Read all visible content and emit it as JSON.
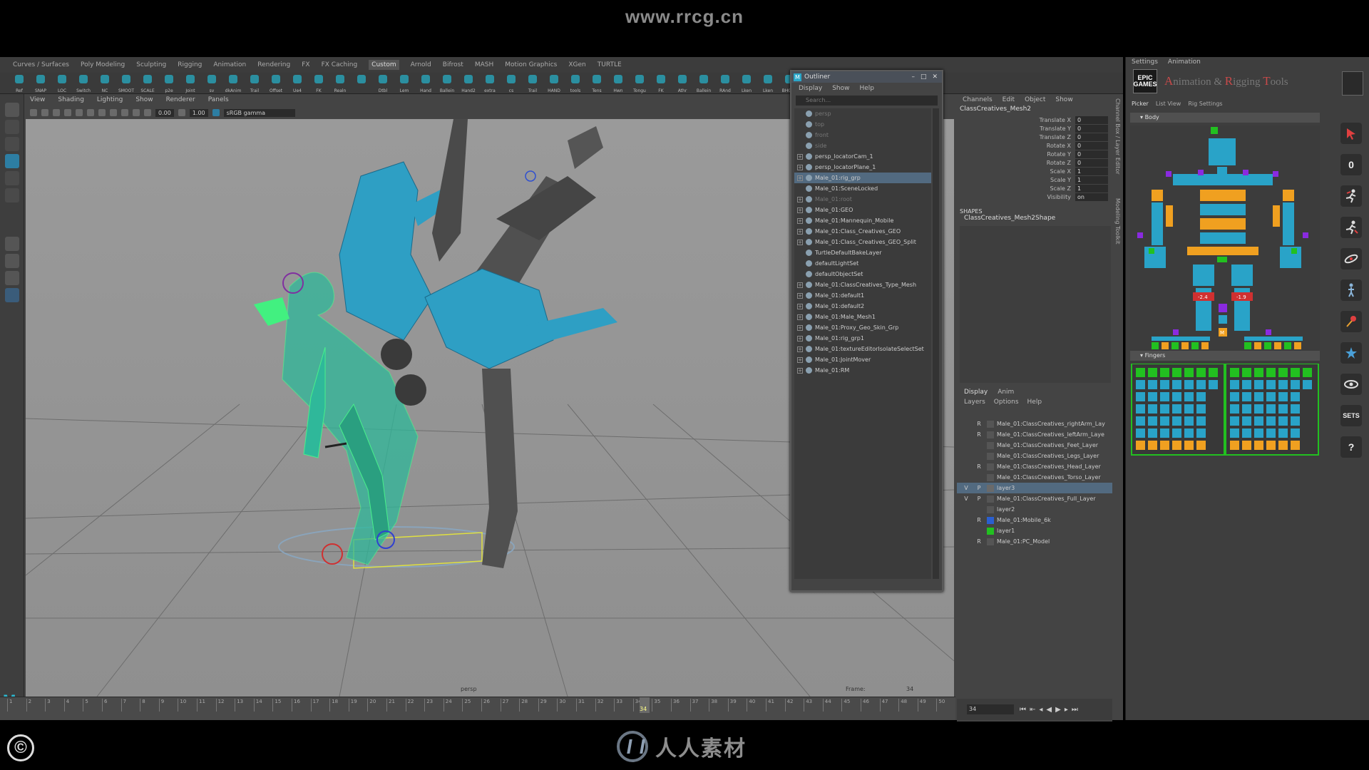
{
  "watermark": {
    "top": "www.rrcg.cn",
    "bottom": "人人素材"
  },
  "copyright_symbol": "©",
  "menubar": {
    "items": [
      "Curves / Surfaces",
      "Poly Modeling",
      "Sculpting",
      "Rigging",
      "Animation",
      "Rendering",
      "FX",
      "FX Caching",
      "Custom",
      "Arnold",
      "Bifrost",
      "MASH",
      "Motion Graphics",
      "XGen",
      "TURTLE"
    ],
    "active_index": 8
  },
  "shelf": [
    "Ref",
    "SNAP",
    "LOC",
    "Switch",
    "NC",
    "SMOOT",
    "SCALE",
    "p2e",
    "Joint",
    "sv",
    "dkAnim",
    "Trail",
    "Offset",
    "Ue4",
    "FK",
    "Realn",
    "",
    "Dtbl",
    "Lem",
    "Hand",
    "Ballein",
    "Hand2",
    "extra",
    "cs",
    "Trail",
    "HAND",
    "tools",
    "Tens",
    "Hwn",
    "Tongu",
    "FK",
    "Athr",
    "Ballein",
    "RAnd",
    "Lken",
    "Lken",
    "BHGho"
  ],
  "viewport": {
    "menu": [
      "View",
      "Shading",
      "Lighting",
      "Show",
      "Renderer",
      "Panels"
    ],
    "exposure": "0.00",
    "gamma": "1.00",
    "color_space": "sRGB gamma",
    "camera_label": "persp",
    "frame_label": "Frame:",
    "frame_value": "34"
  },
  "timeline": {
    "ticks": [
      "1",
      "2",
      "3",
      "4",
      "5",
      "6",
      "7",
      "8",
      "9",
      "10",
      "11",
      "12",
      "13",
      "14",
      "15",
      "16",
      "17",
      "18",
      "19",
      "20",
      "21",
      "22",
      "23",
      "24",
      "25",
      "26",
      "27",
      "28",
      "29",
      "30",
      "31",
      "32",
      "33",
      "34",
      "35",
      "36",
      "37",
      "38",
      "39",
      "40",
      "41",
      "42",
      "43",
      "44",
      "45",
      "46",
      "47",
      "48",
      "49",
      "50"
    ],
    "current": "34"
  },
  "outliner": {
    "title": "Outliner",
    "window_buttons": [
      "–",
      "□",
      "✕"
    ],
    "menu": [
      "Display",
      "Show",
      "Help"
    ],
    "search_placeholder": "Search...",
    "items": [
      {
        "label": "persp",
        "dim": true,
        "exp": false
      },
      {
        "label": "top",
        "dim": true,
        "exp": false
      },
      {
        "label": "front",
        "dim": true,
        "exp": false
      },
      {
        "label": "side",
        "dim": true,
        "exp": false
      },
      {
        "label": "persp_locatorCam_1",
        "dim": false,
        "exp": true
      },
      {
        "label": "persp_locatorPlane_1",
        "dim": false,
        "exp": true
      },
      {
        "label": "Male_01:rig_grp",
        "dim": false,
        "exp": true,
        "sel": true
      },
      {
        "label": "Male_01:SceneLocked",
        "dim": false,
        "exp": false
      },
      {
        "label": "Male_01:root",
        "dim": true,
        "exp": true
      },
      {
        "label": "Male_01:GEO",
        "dim": false,
        "exp": true
      },
      {
        "label": "Male_01:Mannequin_Mobile",
        "dim": false,
        "exp": true
      },
      {
        "label": "Male_01:Class_Creatives_GEO",
        "dim": false,
        "exp": true
      },
      {
        "label": "Male_01:Class_Creatives_GEO_Split",
        "dim": false,
        "exp": true
      },
      {
        "label": "TurtleDefaultBakeLayer",
        "dim": false,
        "exp": false
      },
      {
        "label": "defaultLightSet",
        "dim": false,
        "exp": false
      },
      {
        "label": "defaultObjectSet",
        "dim": false,
        "exp": false
      },
      {
        "label": "Male_01:ClassCreatives_Type_Mesh",
        "dim": false,
        "exp": true
      },
      {
        "label": "Male_01:default1",
        "dim": false,
        "exp": true
      },
      {
        "label": "Male_01:default2",
        "dim": false,
        "exp": true
      },
      {
        "label": "Male_01:Male_Mesh1",
        "dim": false,
        "exp": true
      },
      {
        "label": "Male_01:Proxy_Geo_Skin_Grp",
        "dim": false,
        "exp": true
      },
      {
        "label": "Male_01:rig_grp1",
        "dim": false,
        "exp": true
      },
      {
        "label": "Male_01:textureEditorIsolateSelectSet",
        "dim": false,
        "exp": true
      },
      {
        "label": "Male_01:JointMover",
        "dim": false,
        "exp": true
      },
      {
        "label": "Male_01:RM",
        "dim": false,
        "exp": true
      }
    ]
  },
  "channelbox": {
    "menu": [
      "Channels",
      "Edit",
      "Object",
      "Show"
    ],
    "object": "ClassCreatives_Mesh2",
    "attributes": [
      {
        "name": "Translate X",
        "value": "0"
      },
      {
        "name": "Translate Y",
        "value": "0"
      },
      {
        "name": "Translate Z",
        "value": "0"
      },
      {
        "name": "Rotate X",
        "value": "0"
      },
      {
        "name": "Rotate Y",
        "value": "0"
      },
      {
        "name": "Rotate Z",
        "value": "0"
      },
      {
        "name": "Scale X",
        "value": "1"
      },
      {
        "name": "Scale Y",
        "value": "1"
      },
      {
        "name": "Scale Z",
        "value": "1"
      },
      {
        "name": "Visibility",
        "value": "on"
      }
    ],
    "shapes_label": "SHAPES",
    "shape_name": "ClassCreatives_Mesh2Shape",
    "layer_tabs": [
      "Display",
      "Anim"
    ],
    "layer_menu": [
      "Layers",
      "Options",
      "Help"
    ],
    "layers": [
      {
        "v": "",
        "p": "R",
        "name": "Male_01:ClassCreatives_rightArm_Lay",
        "color": "#555555"
      },
      {
        "v": "",
        "p": "R",
        "name": "Male_01:ClassCreatives_leftArm_Laye",
        "color": "#555555"
      },
      {
        "v": "",
        "p": "",
        "name": "Male_01:ClassCreatives_Feet_Layer",
        "color": "#555555"
      },
      {
        "v": "",
        "p": "",
        "name": "Male_01:ClassCreatives_Legs_Layer",
        "color": "#555555"
      },
      {
        "v": "",
        "p": "R",
        "name": "Male_01:ClassCreatives_Head_Layer",
        "color": "#555555"
      },
      {
        "v": "",
        "p": "",
        "name": "Male_01:ClassCreatives_Torso_Layer",
        "color": "#555555"
      },
      {
        "v": "V",
        "p": "P",
        "name": "layer3",
        "color": "#6a6a6a",
        "sel": true
      },
      {
        "v": "V",
        "p": "P",
        "name": "Male_01:ClassCreatives_Full_Layer",
        "color": "#555555"
      },
      {
        "v": "",
        "p": "",
        "name": "layer2",
        "color": "#555555"
      },
      {
        "v": "",
        "p": "R",
        "name": "Male_01:Mobile_6k",
        "color": "#2a5fd0"
      },
      {
        "v": "",
        "p": "",
        "name": "layer1",
        "color": "#22c020"
      },
      {
        "v": "",
        "p": "R",
        "name": "Male_01:PC_Model",
        "color": "#555555"
      }
    ],
    "frame_field": "34"
  },
  "vertical_tabs": [
    "Channel Box / Layer Editor",
    "Modeling Toolkit"
  ],
  "picker": {
    "top_tabs": [
      "Settings",
      "Animation"
    ],
    "logo": "EPIC GAMES",
    "title_parts": [
      {
        "cap": "A",
        "rest": "nimation & "
      },
      {
        "cap": "R",
        "rest": "igging "
      },
      {
        "cap": "T",
        "rest": "ools"
      }
    ],
    "tabs": [
      "Picker",
      "List View",
      "Rig Settings"
    ],
    "body_section": "Body",
    "fingers_section": "Fingers",
    "value_left": "-2.4",
    "value_right": "-1.9",
    "m_label": "M",
    "side_buttons": [
      "select-arrow",
      "0",
      "run-pose",
      "mirror-pose",
      "swing",
      "figure",
      "pin",
      "star",
      "eye",
      "SETS",
      "?"
    ]
  },
  "colors": {
    "accent": "#29a3c8",
    "orange": "#f0a020",
    "green": "#22c020",
    "purple": "#8a2ae0",
    "red": "#d03030"
  }
}
